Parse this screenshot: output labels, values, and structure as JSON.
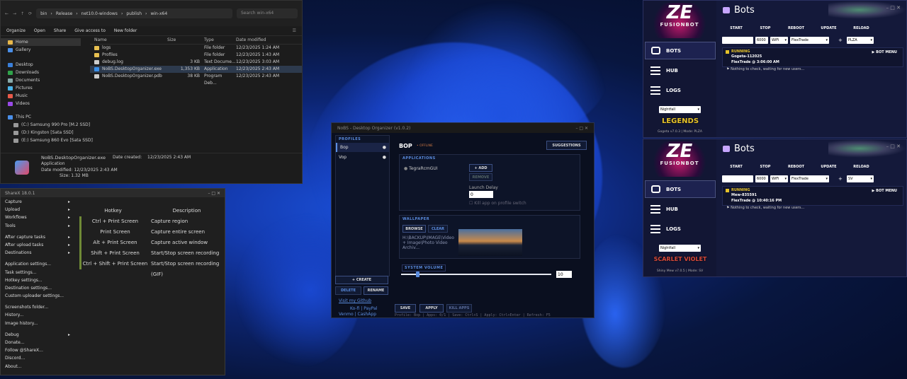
{
  "explorer": {
    "address": [
      "bin",
      "Release",
      "net10.0-windows",
      "publish",
      "win-x64"
    ],
    "search_placeholder": "Search win-x64",
    "commands": [
      "Organize",
      "Open",
      "Share",
      "Give access to",
      "New folder"
    ],
    "nav": [
      "Home",
      "Gallery",
      "Desktop",
      "Downloads",
      "Documents",
      "Pictures",
      "Music",
      "Videos",
      "This PC",
      "(C:) Samsung 990 Pro [M.2 SSD]",
      "(D:) Kingston [Sata SSD]",
      "(E:) Samsung 860 Evo [Sata SSD]"
    ],
    "columns": [
      "Name",
      "Size",
      "Type",
      "Date modified"
    ],
    "files": [
      {
        "name": "logs",
        "size": "",
        "type": "File folder",
        "date": "12/23/2025 1:24 AM",
        "kind": "folder"
      },
      {
        "name": "Profiles",
        "size": "",
        "type": "File folder",
        "date": "12/23/2025 1:43 AM",
        "kind": "folder"
      },
      {
        "name": "debug.log",
        "size": "3 KB",
        "type": "Text Docume...",
        "date": "12/23/2025 3:03 AM",
        "kind": "file"
      },
      {
        "name": "NoBS.DesktopOrganizer.exe",
        "size": "1,353 KB",
        "type": "Application",
        "date": "12/23/2025 2:43 AM",
        "kind": "exe"
      },
      {
        "name": "NoBS.DesktopOrganizer.pdb",
        "size": "38 KB",
        "type": "Program Deb...",
        "date": "12/23/2025 2:43 AM",
        "kind": "file"
      }
    ],
    "details": {
      "name": "NoBS.DesktopOrganizer.exe",
      "type": "Application",
      "created_label": "Date created:",
      "created": "12/23/2025 2:43 AM",
      "modified_label": "Date modified:",
      "modified": "12/23/2025 2:43 AM",
      "size_label": "Size:",
      "size": "1.32 MB"
    }
  },
  "sharex": {
    "title": "ShareX 18.0.1",
    "menu": [
      {
        "label": "Capture",
        "arrow": true
      },
      {
        "label": "Upload",
        "arrow": true
      },
      {
        "label": "Workflows",
        "arrow": true
      },
      {
        "label": "Tools",
        "arrow": true
      },
      {
        "label": "After capture tasks",
        "arrow": true,
        "sep": true
      },
      {
        "label": "After upload tasks",
        "arrow": true
      },
      {
        "label": "Destinations",
        "arrow": true
      },
      {
        "label": "Application settings...",
        "sep": true
      },
      {
        "label": "Task settings..."
      },
      {
        "label": "Hotkey settings..."
      },
      {
        "label": "Destination settings..."
      },
      {
        "label": "Custom uploader settings..."
      },
      {
        "label": "Screenshots folder...",
        "sep": true
      },
      {
        "label": "History..."
      },
      {
        "label": "Image history..."
      },
      {
        "label": "Debug",
        "arrow": true,
        "sep": true
      },
      {
        "label": "Donate..."
      },
      {
        "label": "Follow @ShareX..."
      },
      {
        "label": "Discord..."
      },
      {
        "label": "About..."
      }
    ],
    "hotkey_header": "Hotkey",
    "desc_header": "Description",
    "hotkeys": [
      {
        "key": "Ctrl + Print Screen",
        "desc": "Capture region"
      },
      {
        "key": "Print Screen",
        "desc": "Capture entire screen"
      },
      {
        "key": "Alt + Print Screen",
        "desc": "Capture active window"
      },
      {
        "key": "Shift + Print Screen",
        "desc": "Start/Stop screen recording"
      },
      {
        "key": "Ctrl + Shift + Print Screen",
        "desc": "Start/Stop screen recording (GIF)"
      }
    ]
  },
  "organizer": {
    "title": "NoBS - Desktop Organizer (v1.0.2)",
    "profiles_label": "PROFILES",
    "profiles": [
      "Bop",
      "Vop"
    ],
    "create": "+ CREATE",
    "delete": "DELETE",
    "rename": "RENAME",
    "github": "Visit my Github",
    "kofi": "Ko-fi",
    "paypal": "PayPal",
    "venmo": "Venmo",
    "cashapp": "CashApp",
    "profile_name": "BOP",
    "status": "• OFFLINE",
    "suggestions": "SUGGESTIONS",
    "applications_label": "APPLICATIONS",
    "app": "TegraRcmGUI",
    "add": "+ ADD",
    "remove": "REMOVE",
    "launch_delay": "Launch Delay",
    "delay_value": "0",
    "kill_label": "Kill app on profile switch",
    "wallpaper_label": "WALLPAPER",
    "browse": "BROWSE",
    "clear": "CLEAR",
    "wallpaper_path": "H:\\BACKUP\\IMAGE\\Video + Image\\Photo Video Archiv...",
    "volume_label": "SYSTEM VOLUME",
    "volume": "10",
    "volume_fraction": 0.1,
    "save": "SAVE",
    "apply": "APPLY",
    "kill_apps": "KILL APPS",
    "statusbar": "Profile: Bop | Apps: 0/1 | Save: Ctrl+S | Apply: Ctrl+Enter | Refresh: F5"
  },
  "bots": [
    {
      "logo": "ZE",
      "logo_sub": "FUSIONBOT",
      "title": "Bots",
      "nav": [
        "BOTS",
        "HUB",
        "LOGS"
      ],
      "theme": "Nightfall",
      "game_logo": "LEGENDS",
      "version": "Gogeta v7.0.3 | Mode: PLZA",
      "actions": [
        "START",
        "STOP",
        "REBOOT",
        "UPDATE",
        "RELOAD"
      ],
      "port": "6000",
      "conn": "WiFi",
      "routine": "FlexTrade",
      "plus": "+",
      "game": "PLZA",
      "state": "RUNNING",
      "name": "Gogeta-112025",
      "trade": "FlexTrade @ 3:06:00 AM",
      "msg": "Nothing to check, waiting for new users...",
      "menu": "BOT MENU",
      "accent": "#e6c229"
    },
    {
      "logo": "ZE",
      "logo_sub": "FUSIONBOT",
      "title": "Bots",
      "nav": [
        "BOTS",
        "HUB",
        "LOGS"
      ],
      "theme": "Nightfall",
      "game_logo": "SCARLET VIOLET",
      "version": "Shiny Mew v7.0.5 | Mode: SV",
      "actions": [
        "START",
        "STOP",
        "REBOOT",
        "UPDATE",
        "RELOAD"
      ],
      "port": "6000",
      "conn": "WiFi",
      "routine": "FlexTrade",
      "plus": "+",
      "game": "SV",
      "state": "RUNNING",
      "name": "Mew-835591",
      "trade": "FlexTrade @ 10:40:16 PM",
      "msg": "Nothing to check, waiting for new users...",
      "menu": "BOT MENU",
      "accent": "#e6c229"
    }
  ]
}
